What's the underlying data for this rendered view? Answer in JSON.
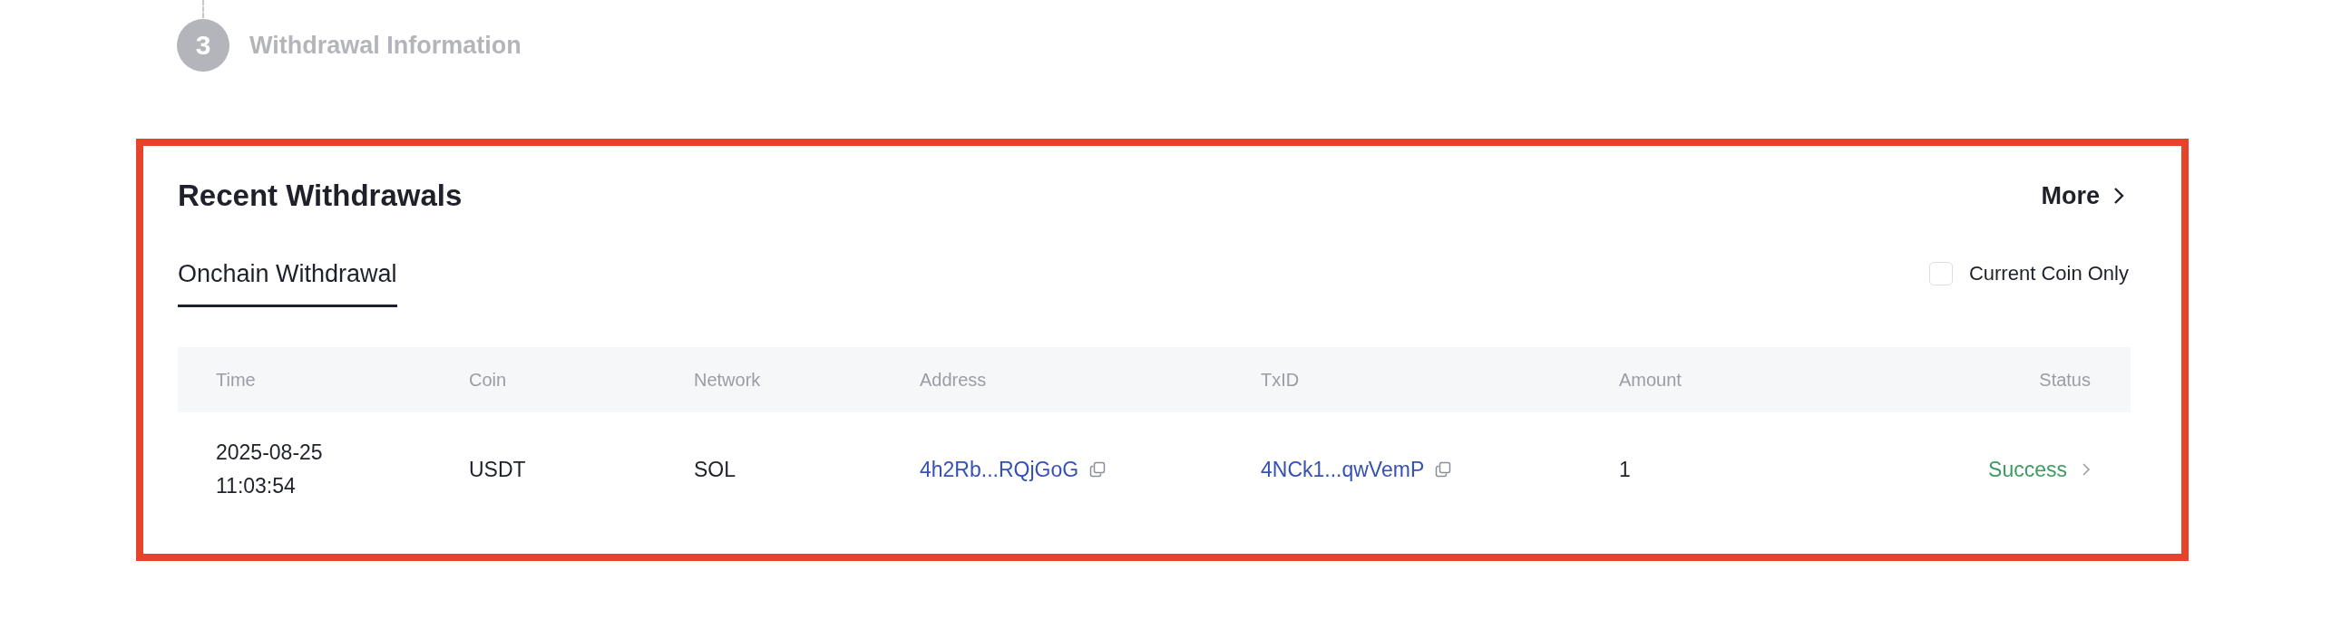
{
  "step": {
    "number": "3",
    "label": "Withdrawal Information",
    "active": false
  },
  "section": {
    "title": "Recent Withdrawals",
    "more_link": "More"
  },
  "tabs": [
    {
      "label": "Onchain Withdrawal",
      "selected": true
    }
  ],
  "filter": {
    "label": "Current Coin Only",
    "checked": false
  },
  "table": {
    "columns": [
      "Time",
      "Coin",
      "Network",
      "Address",
      "TxID",
      "Amount",
      "Status"
    ],
    "rows": [
      {
        "time": "2025-08-25 11:03:54",
        "coin": "USDT",
        "network": "SOL",
        "address": "4h2Rb...RQjGoG",
        "txid": "4NCk1...qwVemP",
        "amount": "1",
        "status": {
          "text": "Success",
          "kind": "success"
        }
      }
    ]
  }
}
